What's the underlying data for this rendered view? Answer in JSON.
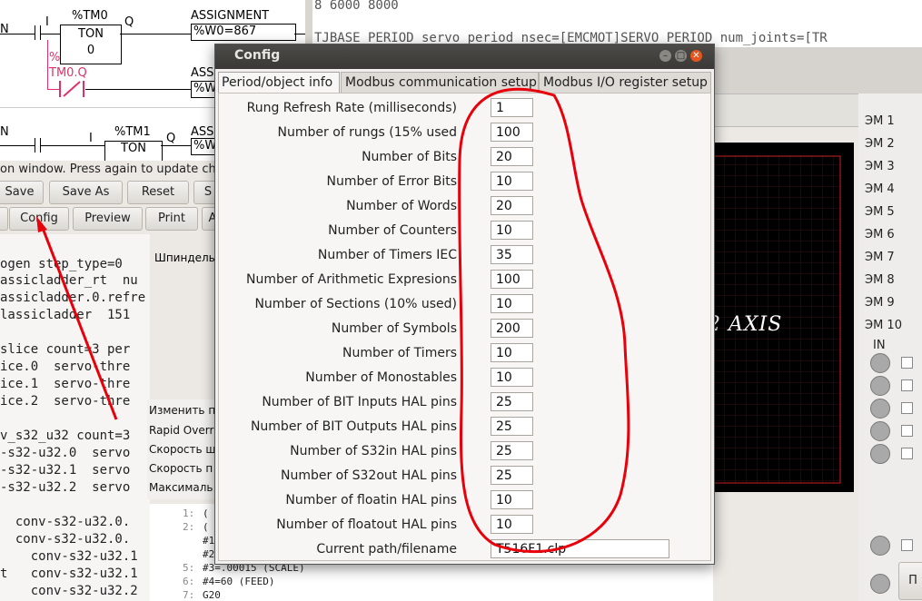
{
  "ladder": {
    "rung1_n": "N",
    "rung1_i": "I",
    "timer1_name": "%TM0",
    "timer1_q": "Q",
    "timer1_type": "TON",
    "timer1_value": "0",
    "assign_label": "ASSIGNMENT",
    "assign_expr": "%W0=867",
    "percent_mark": "%",
    "contact_name": "TM0.Q",
    "assign2_label": "ASS",
    "assign2_expr": "%W",
    "rung2_n": "N",
    "rung2_i": "I",
    "timer2_name": "%TM1",
    "timer2_q": "Q",
    "timer2_type": "TON",
    "assign3_label": "ASS",
    "assign3_expr": "%W"
  },
  "status_line": "on window. Press again to update ch",
  "toolbar1": [
    "Save",
    "Save As",
    "Reset",
    "S"
  ],
  "toolbar2": [
    "",
    "Config",
    "Preview",
    "Print",
    "A"
  ],
  "terminal_lines": [
    "ogen step_type=0",
    "assicladder_rt  nu",
    "assicladder.0.refre",
    "lassicladder  151",
    "",
    "slice count=3 per",
    "ice.0  servo-thre",
    "ice.1  servo-thre",
    "ice.2  servo-thre",
    "",
    "v_s32_u32 count=3",
    "-s32-u32.0  servo",
    "-s32-u32.1  servo",
    "-s32-u32.2  servo",
    "",
    "  conv-s32-u32.0.",
    "  conv-s32-u32.0.",
    "    conv-s32-u32.1",
    "t   conv-s32-u32.1",
    "    conv-s32-u32.2"
  ],
  "bg_text": [
    "8 6000 8000",
    "TJBASE_PERIOD servo_period_nsec=[EMCMOT]SERVO_PERIOD num_joints=[TR"
  ],
  "mid_label": "Шпиндель",
  "list_items": [
    "Изменить п",
    "Rapid Overr",
    "Скорость ш",
    "Скорость п",
    "Максималь"
  ],
  "code_lines": [
    {
      "n": "1:",
      "t": "("
    },
    {
      "n": "2:",
      "t": "("
    },
    {
      "n": "",
      "t": "#1"
    },
    {
      "n": "",
      "t": "#2"
    },
    {
      "n": "5:",
      "t": "#3=.00015 (SCALE)"
    },
    {
      "n": "6:",
      "t": "#4=60 (FEED)"
    },
    {
      "n": "7:",
      "t": "G20"
    }
  ],
  "plot_text": "2 AXIS",
  "em_labels": [
    "ЭМ 1",
    "ЭМ 2",
    "ЭМ 3",
    "ЭМ 4",
    "ЭМ 5",
    "ЭМ 6",
    "ЭМ 7",
    "ЭМ 8",
    "ЭМ 9",
    "ЭМ 10"
  ],
  "in_label": "IN",
  "right_button": "П",
  "dialog": {
    "title": "Config",
    "tabs": [
      "Period/object info",
      "Modbus communication setup",
      "Modbus  I/O register setup"
    ],
    "fields": [
      {
        "label": "Rung Refresh Rate (milliseconds)",
        "value": "1"
      },
      {
        "label": "Number of rungs (15% used",
        "value": "100"
      },
      {
        "label": "Number of Bits",
        "value": "20"
      },
      {
        "label": "Number of Error Bits",
        "value": "10"
      },
      {
        "label": "Number of Words",
        "value": "20"
      },
      {
        "label": "Number of Counters",
        "value": "10"
      },
      {
        "label": "Number of Timers IEC",
        "value": "35"
      },
      {
        "label": "Number of Arithmetic Expresions",
        "value": "100"
      },
      {
        "label": "Number of Sections (10% used)",
        "value": "10"
      },
      {
        "label": "Number of Symbols",
        "value": "200"
      },
      {
        "label": "Number of Timers",
        "value": "10"
      },
      {
        "label": "Number of Monostables",
        "value": "10"
      },
      {
        "label": "Number of BIT Inputs HAL pins",
        "value": "25"
      },
      {
        "label": "Number of BIT Outputs HAL pins",
        "value": "25"
      },
      {
        "label": "Number of S32in HAL pins",
        "value": "25"
      },
      {
        "label": "Number of S32out HAL pins",
        "value": "25"
      },
      {
        "label": "Number of floatin HAL pins",
        "value": "10"
      },
      {
        "label": "Number of floatout HAL pins",
        "value": "10"
      }
    ],
    "path_label": "Current path/filename",
    "path_value": "T516F1.clp"
  },
  "annotation_color": "#e8000b"
}
